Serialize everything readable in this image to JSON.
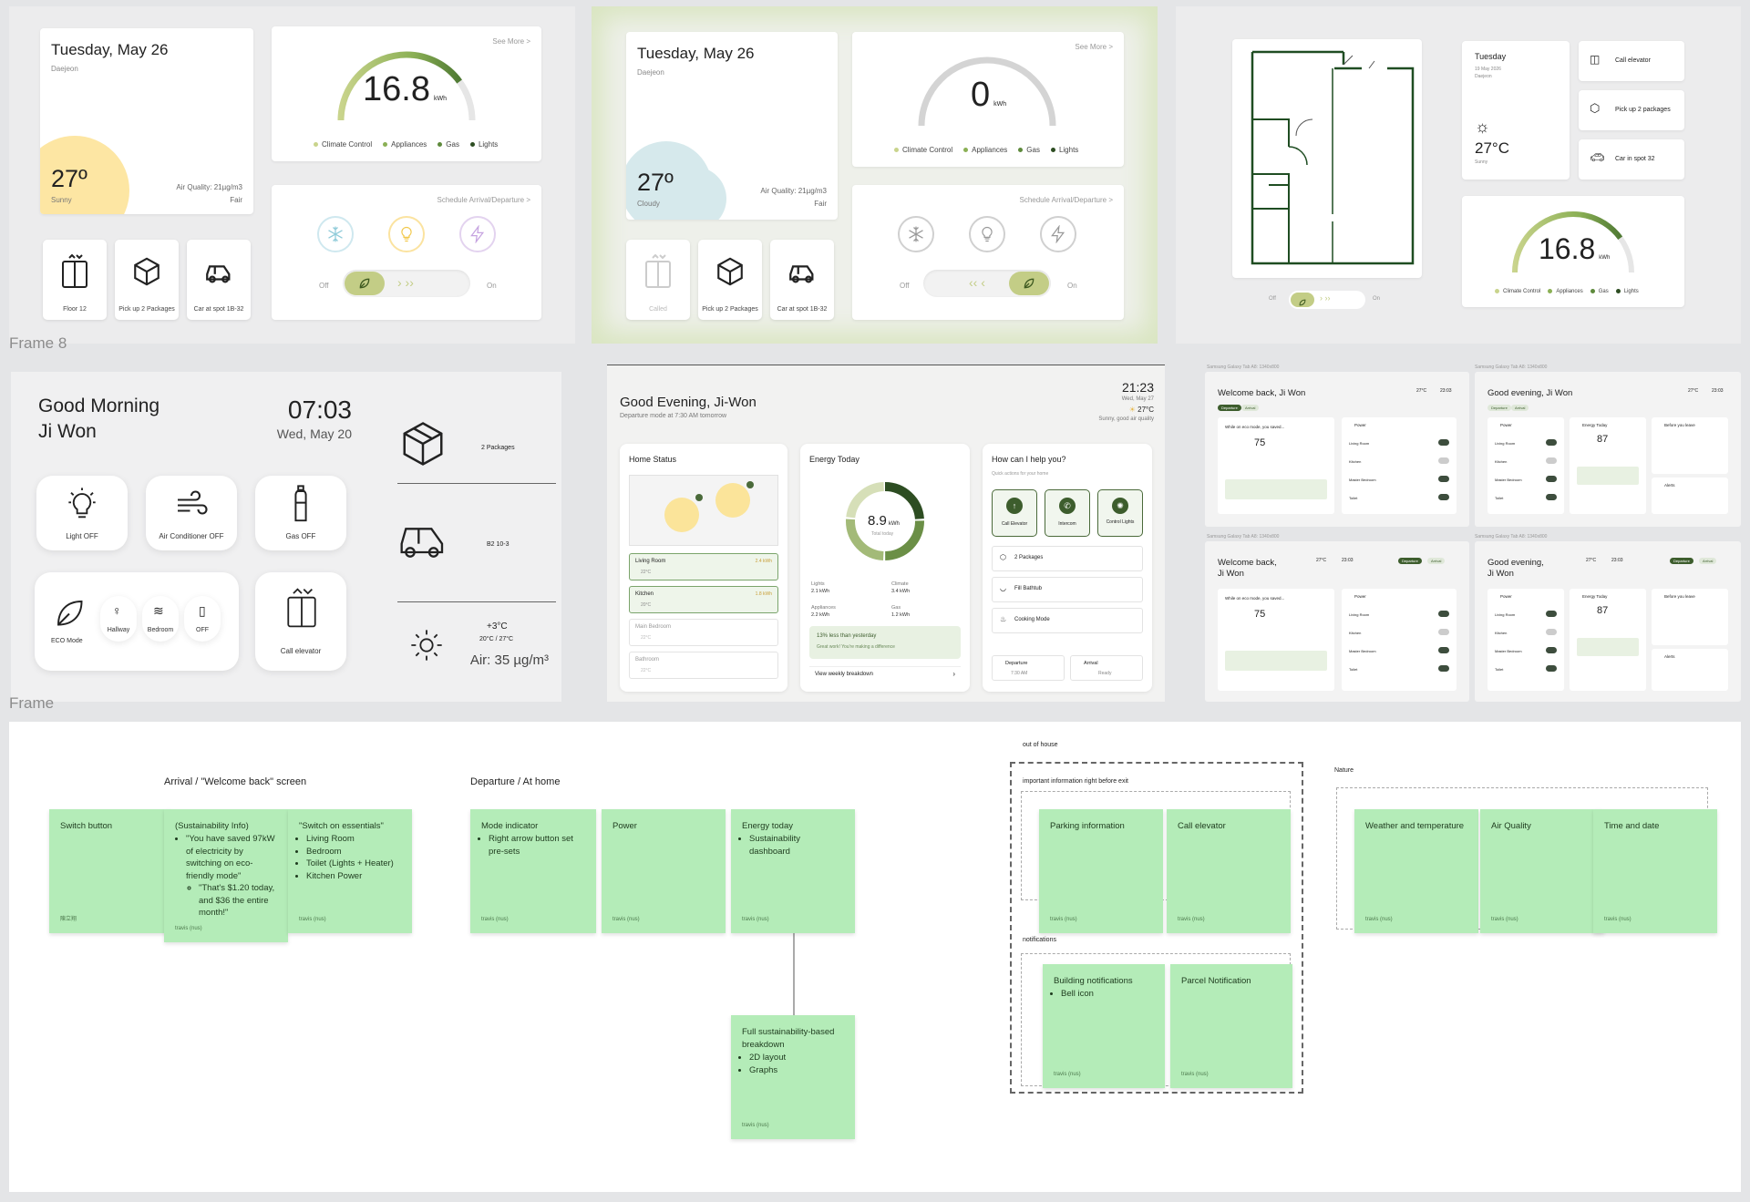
{
  "frame1": {
    "date": "Tuesday, May 26",
    "city": "Daejeon",
    "temp": "27º",
    "condition": "Sunny",
    "air_quality": "Air Quality: 21µg/m3",
    "air_rating": "Fair",
    "see_more": "See More >",
    "energy_value": "16.8",
    "energy_unit": "kWh",
    "energy_fraction": 0.8,
    "legend": [
      "Climate Control",
      "Appliances",
      "Gas",
      "Lights"
    ],
    "schedule": "Schedule Arrival/Departure >",
    "off": "Off",
    "on": "On",
    "tiles": [
      "Floor 12",
      "Pick up 2 Packages",
      "Car at spot 1B-32"
    ]
  },
  "frame2": {
    "date": "Tuesday, May 26",
    "city": "Daejeon",
    "temp": "27º",
    "condition": "Cloudy",
    "air_quality": "Air Quality: 21µg/m3",
    "air_rating": "Fair",
    "see_more": "See More >",
    "energy_value": "0",
    "energy_unit": "kWh",
    "legend": [
      "Climate Control",
      "Appliances",
      "Gas",
      "Lights"
    ],
    "schedule": "Schedule Arrival/Departure >",
    "off": "Off",
    "on": "On",
    "tiles": [
      "Called",
      "Pick up 2 Packages",
      "Car at spot 1B-32"
    ]
  },
  "frame3": {
    "day": "Tuesday",
    "date": "19 May 2026",
    "city": "Daejeon",
    "temp": "27°C",
    "condition": "Sunny",
    "actions": [
      "Call elevator",
      "Pick up 2 packages",
      "Car in spot 32"
    ],
    "energy_value": "16.8",
    "energy_unit": "kWh",
    "energy_fraction": 0.8,
    "legend": [
      "Climate Control",
      "Appliances",
      "Gas",
      "Lights"
    ],
    "off": "Off",
    "on": "On"
  },
  "labels": {
    "frame8": "Frame 8",
    "frame": "Frame"
  },
  "device_label": "Samsung Galaxy Tab A8: 1340x800",
  "frame4": {
    "greeting_1": "Good Morning",
    "greeting_2": "Ji Won",
    "time": "07:03",
    "date": "Wed, May 20",
    "tiles": [
      "Light OFF",
      "Air Conditioner OFF",
      "Gas OFF"
    ],
    "eco": "ECO Mode",
    "eco_rooms": [
      "Hallway",
      "Bedroom",
      "OFF"
    ],
    "elevator": "Call elevator",
    "packages": "2 Packages",
    "parking": "B2 10-3",
    "weather_temp": "+3°C",
    "weather_range": "20°C / 27°C",
    "air": "Air: 35 µg/m³"
  },
  "frame5": {
    "greeting": "Good Evening, Ji-Won",
    "mode": "Departure mode at 7:30 AM tomorrow",
    "time": "21:23",
    "date": "Wed, May 27",
    "temp": "27°C",
    "weather": "Sunny, good air quality",
    "home_status": "Home Status",
    "rooms": [
      {
        "name": "Living Room",
        "temp": "22°C",
        "kwh": "2.4 kWh"
      },
      {
        "name": "Kitchen",
        "temp": "20°C",
        "kwh": "1.8 kWh"
      },
      {
        "name": "Main Bedroom",
        "temp": "22°C"
      },
      {
        "name": "Bathroom",
        "temp": "22°C"
      }
    ],
    "energy_title": "Energy Today",
    "energy_value": "8.9",
    "energy_unit": "kWh",
    "energy_caption": "Total today",
    "breakdown": [
      {
        "name": "Lights",
        "value": "2.1 kWh"
      },
      {
        "name": "Climate",
        "value": "3.4 kWh"
      },
      {
        "name": "Appliances",
        "value": "2.2 kWh"
      },
      {
        "name": "Gas",
        "value": "1.2 kWh"
      }
    ],
    "saving": "13% less than yesterday",
    "saving_sub": "Great work! You're making a difference",
    "weekly": "View weekly breakdown",
    "help_title": "How can I help you?",
    "help_sub": "Quick actions for your home",
    "quick": [
      "Call Elevator",
      "Intercom",
      "Control Lights"
    ],
    "list": [
      "2 Packages",
      "Fill Bathtub",
      "Cooking Mode"
    ],
    "departure": "Departure",
    "departure_time": "7:30 AM",
    "arrival": "Arrival",
    "arrival_status": "Ready"
  },
  "frame6": {
    "titles": [
      "Welcome back, Ji Won",
      "Good evening, Ji Won",
      "Welcome back,",
      "Good evening,"
    ],
    "name": "Ji Won",
    "temp": "27°C",
    "time": "23:03",
    "tabs": [
      "Departure",
      "Arrival"
    ],
    "eco_text": "While on eco mode, you saved...",
    "saved_value": "75",
    "power": "Power",
    "rooms": [
      "Living Room",
      "Kitchen",
      "Master Bedroom",
      "Toilet"
    ],
    "energy_today": "Energy Today",
    "energy_value": "87",
    "before_leave": "Before you leave",
    "alerts": "Alerts"
  },
  "board": {
    "section_titles": [
      "Arrival / \"Welcome back\" screen",
      "Departure / At home"
    ],
    "author": "travis (nus)",
    "sticky_1": {
      "title": "Switch button",
      "author": "陳立翔"
    },
    "sticky_2": {
      "title": "(Sustainability Info)",
      "lines": [
        "\"You have saved 97kW",
        "of electricity by",
        "switching on eco-",
        "friendly mode\""
      ],
      "sub": [
        "\"That's $1.20 today,",
        "and $36 the entire",
        "month!\""
      ]
    },
    "sticky_3": {
      "title": "\"Switch on essentials\"",
      "items": [
        "Living Room",
        "Bedroom",
        "Toilet (Lights + Heater)",
        "Kitchen Power"
      ]
    },
    "sticky_4": {
      "title": "Mode indicator",
      "items": [
        "Right arrow button set",
        "pre-sets"
      ]
    },
    "sticky_5": {
      "title": "Power"
    },
    "sticky_6": {
      "title": "Energy today",
      "items": [
        "Sustainability",
        "dashboard"
      ]
    },
    "sticky_7": {
      "title": "Full sustainability-based",
      "title2": "breakdown",
      "items": [
        "2D layout",
        "Graphs"
      ]
    },
    "out_of_house": "out of house",
    "important": "important information right before exit",
    "parking": "Parking information",
    "call_elevator": "Call elevator",
    "notifications": "notifications",
    "building": "Building notifications",
    "bell": "Bell icon",
    "parcel": "Parcel Notification",
    "nature": "Nature",
    "weather": "Weather and temperature",
    "air_quality": "Air Quality",
    "time_date": "Time and date"
  },
  "colors": {
    "accent": "#5e8a3c",
    "dark_green": "#2d4d22",
    "sticky": "#b4ecb8",
    "sun": "#fde6a3",
    "cloud": "#d6e9ec"
  }
}
